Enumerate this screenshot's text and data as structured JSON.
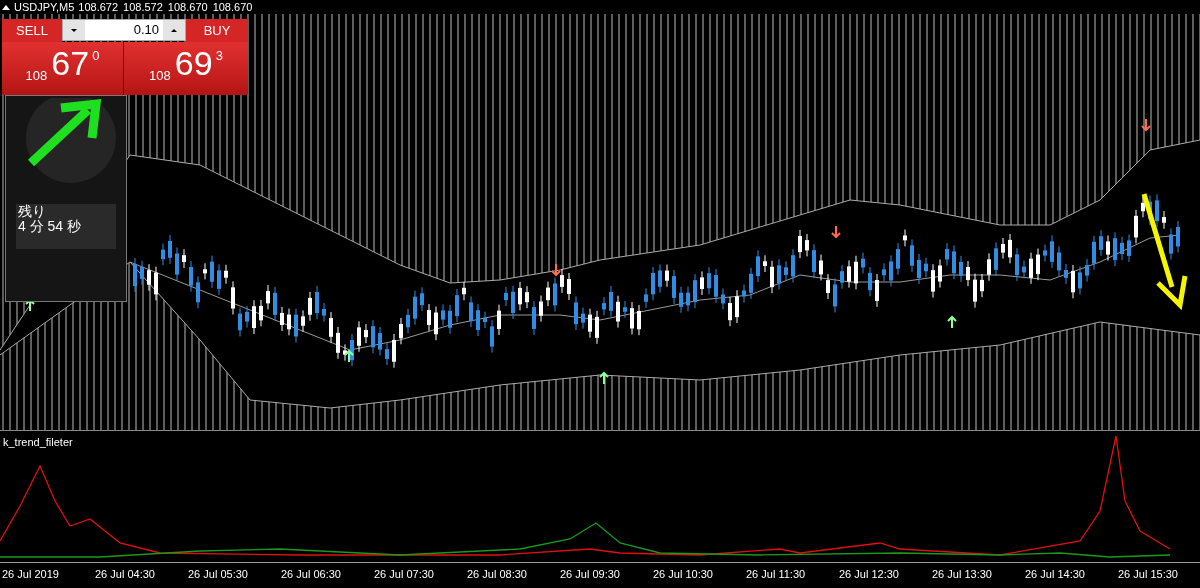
{
  "chart": {
    "symbol_title": "USDJPY,M5",
    "quotes": [
      "108.672",
      "108.572",
      "108.670",
      "108.670"
    ]
  },
  "trade_panel": {
    "sell_label": "SELL",
    "buy_label": "BUY",
    "lot": "0.10",
    "sell_price": {
      "prefix": "108",
      "main": "67",
      "sup": "0"
    },
    "buy_price": {
      "prefix": "108",
      "main": "69",
      "sup": "3"
    }
  },
  "timer": {
    "label": "残り",
    "minutes": "4",
    "minutes_unit": "分",
    "seconds": "54",
    "seconds_unit": "秒"
  },
  "indicator": {
    "name": "k_trend_fileter"
  },
  "time_axis": [
    "26 Jul 2019",
    "26 Jul 04:30",
    "26 Jul 05:30",
    "26 Jul 06:30",
    "26 Jul 07:30",
    "26 Jul 08:30",
    "26 Jul 09:30",
    "26 Jul 10:30",
    "26 Jul 11:30",
    "26 Jul 12:30",
    "26 Jul 13:30",
    "26 Jul 14:30",
    "26 Jul 15:30"
  ]
}
